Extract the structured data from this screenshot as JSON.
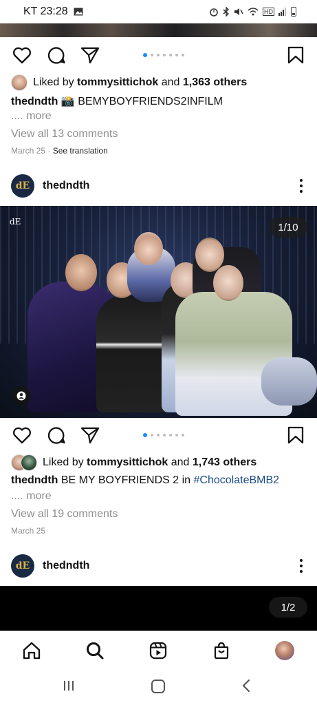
{
  "status_bar": {
    "carrier_time": "KT 23:28",
    "icons": [
      "image-icon",
      "alarm-icon",
      "bluetooth-icon",
      "mute-icon",
      "wifi-icon",
      "hd-icon",
      "signal-icon",
      "battery-icon"
    ],
    "hd_label": "HD"
  },
  "post1": {
    "carousel_dots": 7,
    "active_dot": 0,
    "liked_by_prefix": "Liked by",
    "liked_by_user": "tommysittichok",
    "liked_by_and": "and",
    "liked_by_count": "1,363 others",
    "caption_user": "thedndth",
    "caption_emoji": "📸",
    "caption_text": "BEMYBOYFRIENDS2INFILM",
    "more": ".... more",
    "view_comments": "View all 13 comments",
    "date": "March 25",
    "translation": "See translation"
  },
  "post2": {
    "username": "thedndth",
    "logo_text": "dE",
    "counter": "1/10",
    "carousel_dots": 7,
    "active_dot": 0,
    "liked_by_prefix": "Liked by",
    "liked_by_user": "tommysittichok",
    "liked_by_and": "and",
    "liked_by_count": "1,743 others",
    "caption_user": "thedndth",
    "caption_text": "BE MY BOYFRIENDS 2 in",
    "caption_tag": "#ChocolateBMB2",
    "more": ".... more",
    "view_comments": "View all 19 comments",
    "date": "March 25"
  },
  "post3": {
    "username": "thedndth",
    "logo_text": "dE",
    "counter": "1/2"
  },
  "colors": {
    "accent": "#1a8cff",
    "muted_text": "#8e8e8e",
    "hashtag": "#1a4b86",
    "logo_bg": "#1b2a44",
    "logo_fg": "#d8b24a"
  },
  "bottom_nav": [
    "home-icon",
    "search-icon",
    "reels-icon",
    "shop-icon",
    "profile-avatar"
  ],
  "system_nav": [
    "recents-icon",
    "home-button-icon",
    "back-icon"
  ]
}
